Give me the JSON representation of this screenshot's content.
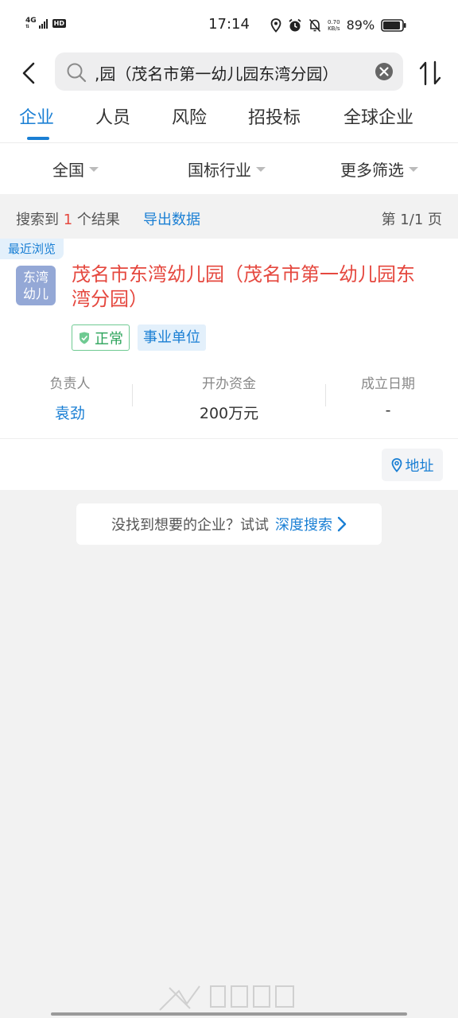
{
  "status_bar": {
    "network": "4G",
    "hd": "HD",
    "time": "17:14",
    "speed_value": "0.70",
    "speed_unit": "KB/s",
    "battery": "89%"
  },
  "header": {
    "search_text": ",园（茂名市第一幼儿园东湾分园）",
    "back_icon": "chevron-left-icon",
    "search_icon": "search-icon",
    "clear_icon": "clear-icon",
    "sort_icon": "sort-icon"
  },
  "tabs": [
    {
      "label": "企业",
      "active": true
    },
    {
      "label": "人员"
    },
    {
      "label": "风险"
    },
    {
      "label": "招投标"
    },
    {
      "label": "全球企业"
    }
  ],
  "filters": [
    {
      "label": "全国"
    },
    {
      "label": "国标行业"
    },
    {
      "label": "更多筛选"
    }
  ],
  "result_bar": {
    "prefix": "搜索到",
    "count": "1",
    "suffix": "个结果",
    "export": "导出数据",
    "page": "第 1/1 页"
  },
  "company": {
    "recent_tag": "最近浏览",
    "logo_line1": "东湾",
    "logo_line2": "幼儿",
    "logo_color": "#94a8d6",
    "name": "茂名市东湾幼儿园（茂名市第一幼儿园东湾分园）",
    "status": "正常",
    "type": "事业单位",
    "info": [
      {
        "label": "负责人",
        "value": "袁劲"
      },
      {
        "label": "开办资金",
        "value": "200万元"
      },
      {
        "label": "成立日期",
        "value": "-"
      }
    ],
    "address_button": "地址"
  },
  "deep_search": {
    "prompt": "没找到想要的企业？试试",
    "link": "深度搜索"
  },
  "colors": {
    "accent": "#1a7fd4",
    "highlight": "#e5483f",
    "status_green": "#2ba35a"
  }
}
